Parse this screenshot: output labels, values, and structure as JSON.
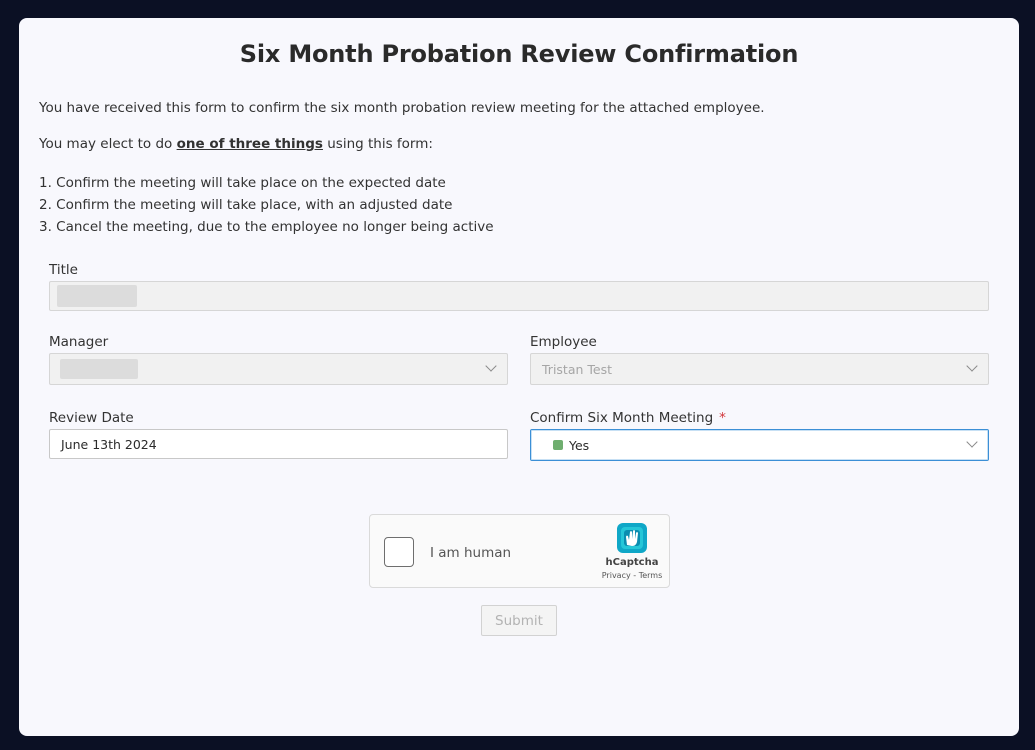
{
  "form": {
    "title": "Six Month Probation Review Confirmation",
    "intro_line1": "You have received this form to confirm the six month probation review meeting for the attached employee.",
    "intro_line2_prefix": "You may elect to do ",
    "intro_line2_emphasis": "one of three things",
    "intro_line2_suffix": " using this form:",
    "steps": [
      "1. Confirm the meeting will take place on the expected date",
      "2. Confirm the meeting will take place, with an adjusted date",
      "3. Cancel the meeting, due to the employee no longer being active"
    ]
  },
  "fields": {
    "title_label": "Title",
    "title_value": "",
    "manager_label": "Manager",
    "manager_value": "",
    "employee_label": "Employee",
    "employee_value": "Tristan Test",
    "review_date_label": "Review Date",
    "review_date_value": "June 13th 2024",
    "confirm_label": "Confirm Six Month Meeting",
    "confirm_required_marker": "*",
    "confirm_value": "Yes",
    "confirm_status_color": "#6fae6f"
  },
  "captcha": {
    "checkbox_label": "I am human",
    "brand": "hCaptcha",
    "links": "Privacy - Terms"
  },
  "submit_label": "Submit",
  "colors": {
    "page_background": "#0b1024",
    "card_background": "#f8f8fd",
    "focus_border": "#3b8fd6",
    "required": "#d13438"
  }
}
